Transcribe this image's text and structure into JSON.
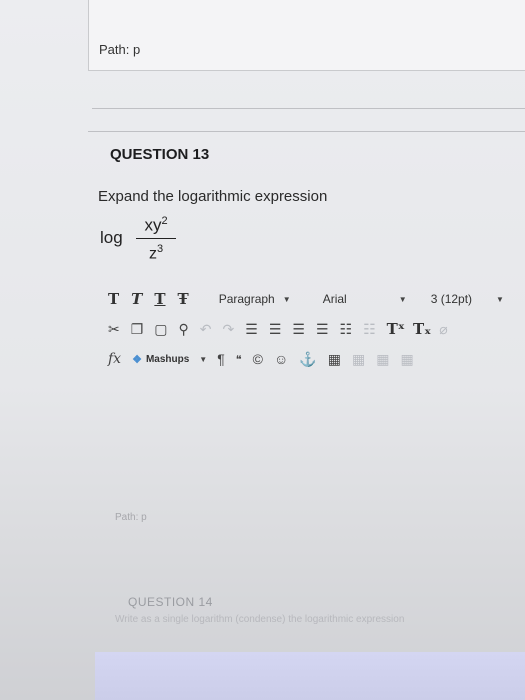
{
  "previous": {
    "path_label": "Path: p"
  },
  "question": {
    "title": "QUESTION 13",
    "prompt": "Expand the logarithmic expression",
    "formula": {
      "log": "log",
      "numerator_base": "xy",
      "numerator_exp": "2",
      "denominator_base": "z",
      "denominator_exp": "3"
    }
  },
  "editor": {
    "format_buttons": [
      "T",
      "T",
      "T",
      "Ŧ"
    ],
    "paragraph": "Paragraph",
    "font": "Arial",
    "size": "3 (12pt)",
    "mashups": "Mashups",
    "fx": "fx",
    "path_label": "Path: p"
  },
  "next_question": {
    "title": "QUESTION 14",
    "prompt": "Write as a single logarithm (condense) the logarithmic expression"
  }
}
